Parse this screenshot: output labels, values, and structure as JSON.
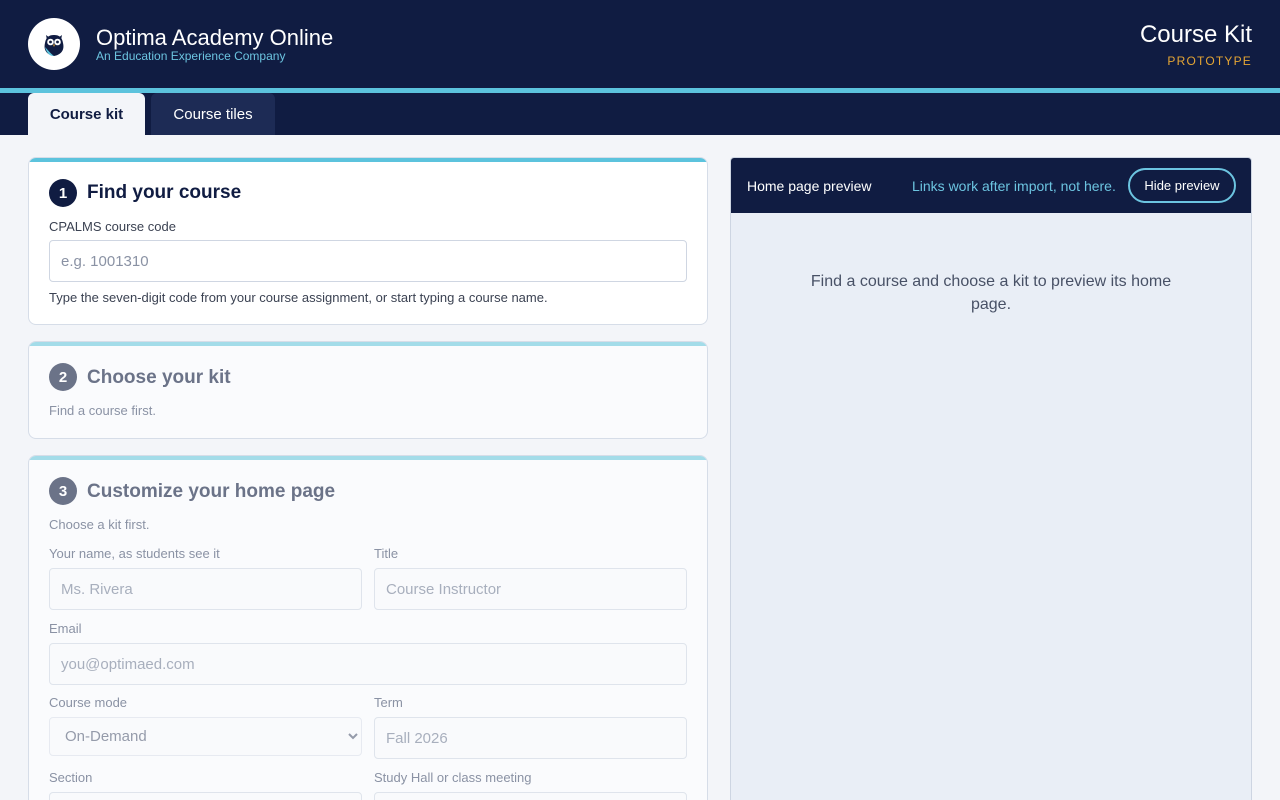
{
  "header": {
    "brand_title": "Optima Academy Online",
    "brand_subtitle": "An Education Experience Company",
    "logo_icon": "owl-icon",
    "app_title": "Course Kit",
    "badge": "PROTOTYPE"
  },
  "tabs": [
    {
      "label": "Course kit",
      "active": true
    },
    {
      "label": "Course tiles",
      "active": false
    }
  ],
  "step1": {
    "number": "1",
    "title": "Find your course",
    "field_label": "CPALMS course code",
    "placeholder": "e.g. 1001310",
    "help": "Type the seven-digit code from your course assignment, or start typing a course name."
  },
  "step2": {
    "number": "2",
    "title": "Choose your kit",
    "hint": "Find a course first."
  },
  "step3": {
    "number": "3",
    "title": "Customize your home page",
    "hint": "Choose a kit first.",
    "name_label": "Your name, as students see it",
    "name_placeholder": "Ms. Rivera",
    "title_label": "Title",
    "title_placeholder": "Course Instructor",
    "email_label": "Email",
    "email_placeholder": "you@optimaed.com",
    "mode_label": "Course mode",
    "mode_value": "On-Demand",
    "term_label": "Term",
    "term_placeholder": "Fall 2026",
    "section_label": "Section",
    "meeting_label": "Study Hall or class meeting"
  },
  "preview": {
    "title": "Home page preview",
    "note": "Links work after import, not here.",
    "hide_button": "Hide preview",
    "empty_message": "Find a course and choose a kit to preview its home page."
  },
  "colors": {
    "navy": "#101c42",
    "accent": "#5cc3dd",
    "badge": "#e5a534"
  }
}
